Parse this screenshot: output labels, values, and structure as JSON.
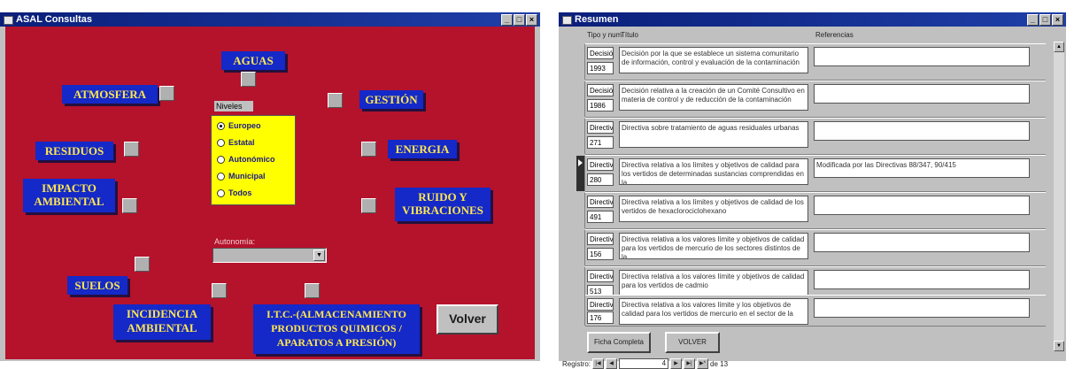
{
  "consultas": {
    "title": "ASAL Consultas",
    "categories": {
      "aguas": "AGUAS",
      "atmosfera": "ATMOSFERA",
      "gestion": "GESTIÓN",
      "residuos": "RESIDUOS",
      "energia": "ENERGIA",
      "impacto": "IMPACTO AMBIENTAL",
      "ruido": "RUIDO Y VIBRACIONES",
      "suelos": "SUELOS",
      "incidencia": "INCIDENCIA AMBIENTAL",
      "ltc": "I.T.C.-(ALMACENAMIENTO PRODUCTOS QUIMICOS / APARATOS A PRESIÓN)"
    },
    "niveles": {
      "title": "Niveles",
      "options": [
        "Europeo",
        "Estatal",
        "Autonómico",
        "Municipal",
        "Todos"
      ],
      "selected": "Europeo"
    },
    "autonomia_label": "Autonomía:",
    "volver": "Volver"
  },
  "resumen": {
    "title": "Resumen",
    "headers": {
      "tipo": "Tipo y num",
      "titulo": "Título",
      "referencias": "Referencias"
    },
    "rows": [
      {
        "tipo": "Decisión",
        "num": "1993",
        "titulo": "Decisión por la que se establece un sistema comunitario de información, control y evaluación de la contaminación",
        "ref": ""
      },
      {
        "tipo": "Decisión",
        "num": "1986",
        "titulo": "Decisión relativa a la creación de un Comité Consultivo en materia de control y de reducción de la contaminación",
        "ref": ""
      },
      {
        "tipo": "Directiva",
        "num": "271",
        "titulo": "Directiva sobre tratamiento de aguas residuales urbanas",
        "ref": ""
      },
      {
        "tipo": "Directiva",
        "num": "280",
        "titulo": "Directiva relativa a los límites y objetivos de calidad para los vertidos de determinadas sustancias comprendidas en la",
        "ref": "Modificada por las Directivas 88/347, 90/415"
      },
      {
        "tipo": "Directiva",
        "num": "491",
        "titulo": "Directiva relativa a los límites y objetivos de calidad de los vertidos de hexaclorociclohexano",
        "ref": ""
      },
      {
        "tipo": "Directiva",
        "num": "156",
        "titulo": "Directiva relativa a los valores límite y objetivos de calidad para los vertidos de mercurio de los sectores distintos de la",
        "ref": ""
      },
      {
        "tipo": "Directiva",
        "num": "513",
        "titulo": "Directiva relativa a los valores límite y objetivos de calidad para los vertidos de cadmio",
        "ref": ""
      },
      {
        "tipo": "Directiva",
        "num": "176",
        "titulo": "Directiva relativa a los valores límite y los objetivos de calidad para los vertidos de mercurio en el sector de la",
        "ref": ""
      }
    ],
    "buttons": {
      "ficha": "Ficha Completa",
      "volver": "VOLVER"
    },
    "nav": {
      "label": "Registro:",
      "current": "4",
      "of_label": "de 13"
    }
  }
}
